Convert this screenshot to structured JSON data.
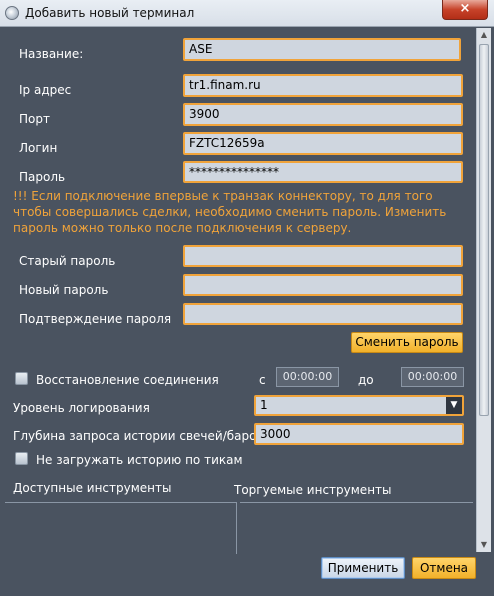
{
  "window": {
    "title": "Добавить новый терминал",
    "close_label": "×"
  },
  "form": {
    "name_label": "Название:",
    "name_value": "ASE",
    "ip_label": "Ip адрес",
    "ip_value": "tr1.finam.ru",
    "port_label": "Порт",
    "port_value": "3900",
    "login_label": "Логин",
    "login_value": "FZTC12659a",
    "password_label": "Пароль",
    "password_value": "***************",
    "warning": "!!! Если подключение впервые к транзак коннектору, то для того чтобы совершались сделки, необходимо сменить пароль. Изменить пароль можно только после подключения к серверу.",
    "old_password_label": "Старый пароль",
    "new_password_label": "Новый пароль",
    "confirm_password_label": "Подтверждение пароля",
    "change_password_button": "Сменить пароль"
  },
  "reconnect": {
    "label": "Восстановление соединения",
    "from_label": "с",
    "from_value": "00:00:00",
    "to_label": "до",
    "to_value": "00:00:00"
  },
  "logging": {
    "label": "Уровень логирования",
    "value": "1"
  },
  "history": {
    "depth_label": "Глубина запроса истории свечей/баров",
    "depth_value": "3000",
    "no_ticks_label": "Не загружать историю по тикам"
  },
  "instruments": {
    "available_label": "Доступные инструменты",
    "traded_label": "Торгуемые инструменты"
  },
  "buttons": {
    "apply": "Применить",
    "cancel": "Отмена"
  }
}
